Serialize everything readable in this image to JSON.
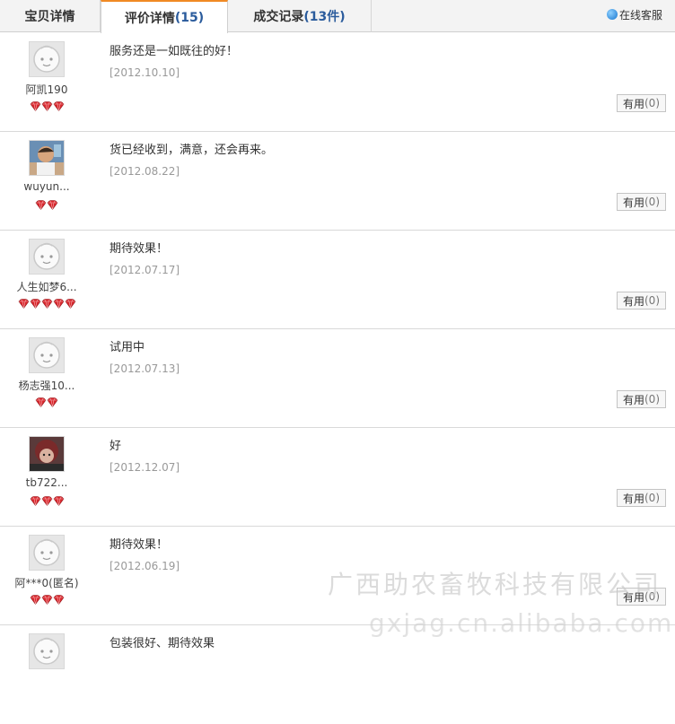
{
  "tabs": [
    {
      "label": "宝贝详情",
      "count": ""
    },
    {
      "label": "评价详情",
      "count": "(15)"
    },
    {
      "label": "成交记录",
      "count": "(13件)"
    }
  ],
  "service_label": "在线客服",
  "useful_label": "有用",
  "reviews": [
    {
      "user": "阿凯190",
      "gems": 3,
      "comment": "服务还是一如既往的好！",
      "date": "[2012.10.10]",
      "useful": "(0)",
      "avatar": "default-avatar"
    },
    {
      "user": "wuyun...",
      "gems": 2,
      "comment": "货已经收到，满意，还会再来。",
      "date": "[2012.08.22]",
      "useful": "(0)",
      "avatar": "photo-child"
    },
    {
      "user": "人生如梦6...",
      "gems": 5,
      "comment": "期待效果！",
      "date": "[2012.07.17]",
      "useful": "(0)",
      "avatar": "default-avatar"
    },
    {
      "user": "杨志强10...",
      "gems": 2,
      "comment": "试用中",
      "date": "[2012.07.13]",
      "useful": "(0)",
      "avatar": "default-avatar"
    },
    {
      "user": "tb722...",
      "gems": 3,
      "comment": "好",
      "date": "[2012.12.07]",
      "useful": "(0)",
      "avatar": "photo-dark"
    },
    {
      "user": "阿***0(匿名)",
      "gems": 3,
      "comment": "期待效果！",
      "date": "[2012.06.19]",
      "useful": "(0)",
      "avatar": "default-avatar"
    },
    {
      "user": "",
      "gems": 0,
      "comment": "包装很好、期待效果",
      "date": "",
      "useful": "",
      "avatar": "default-avatar"
    }
  ],
  "watermark": {
    "line1": "广西助农畜牧科技有限公司",
    "line2": "gxjag.cn.alibaba.com"
  },
  "colors": {
    "active_tab_accent": "#f08a24",
    "count": "#2a5b9c",
    "gem": "#d9262c"
  }
}
